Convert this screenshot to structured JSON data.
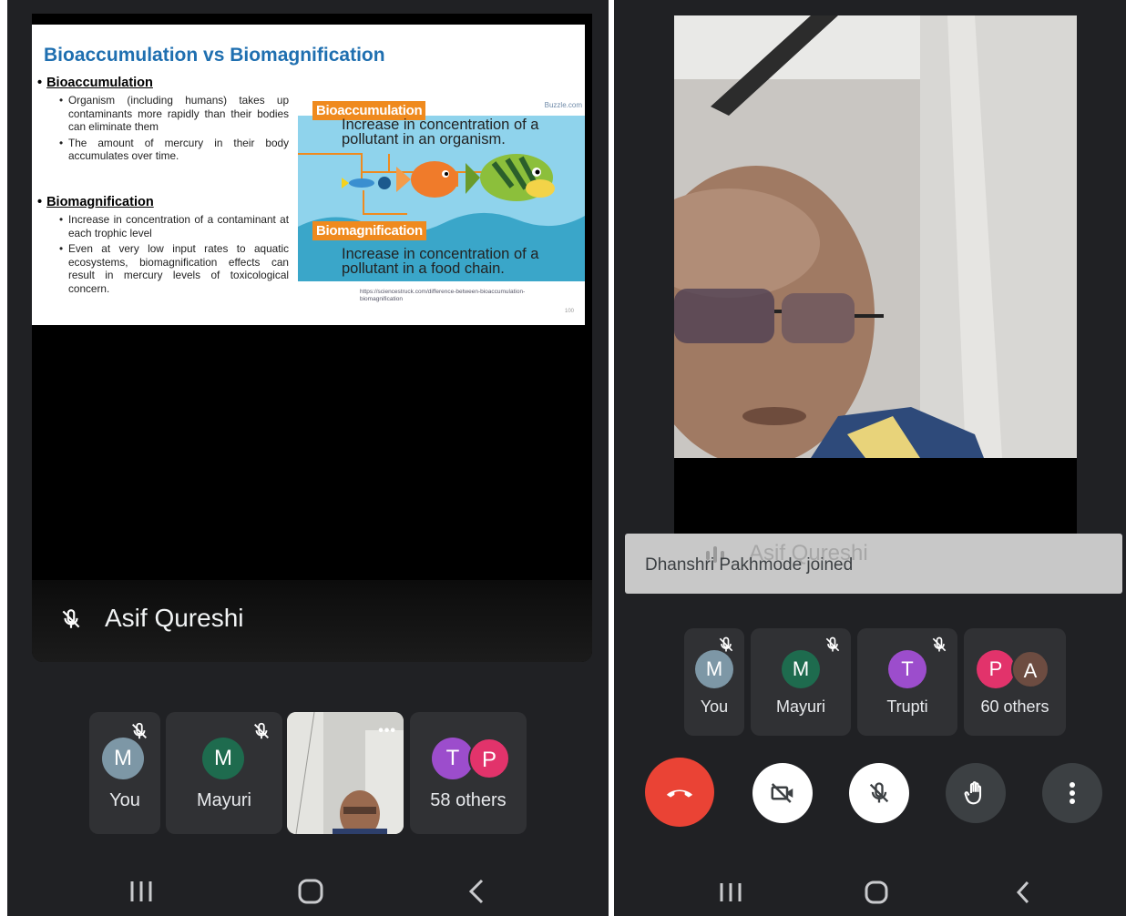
{
  "left": {
    "slide": {
      "title": "Bioaccumulation vs Biomagnification",
      "section1": "Bioaccumulation",
      "section1_bullets": [
        "Organism (including humans) takes up contaminants more rapidly than their bodies can eliminate them",
        "The amount of mercury in their body accumulates over time."
      ],
      "section2": "Biomagnification",
      "section2_bullets": [
        "Increase in concentration of a contaminant at each trophic level",
        "Even at very low input rates to aquatic ecosystems, biomagnification effects can result in mercury levels of toxicological concern."
      ],
      "illustration": {
        "credit": "Buzzle.com",
        "tag1": "Bioaccumulation",
        "desc1": "Increase in concentration of a pollutant in an organism.",
        "tag2": "Biomagnification",
        "desc2": "Increase in concentration of a pollutant in a food chain."
      },
      "source": "https://sciencestruck.com/difference-between-bioaccumulation-biomagnification",
      "page": "100"
    },
    "speaker_name": "Asif Qureshi",
    "participants": [
      {
        "initial": "M",
        "label": "You",
        "color": "#7d97a6",
        "muted": true
      },
      {
        "initial": "M",
        "label": "Mayuri",
        "color": "#1e6b4e",
        "muted": true
      }
    ],
    "others": {
      "initials": [
        "T",
        "P"
      ],
      "colors": [
        "#9c4dcc",
        "#e2336b"
      ],
      "label": "58 others"
    },
    "more_icon": "more-horizontal-icon"
  },
  "right": {
    "toast": "Dhanshri Pakhmode joined",
    "speaker_name": "Asif Qureshi",
    "participants": [
      {
        "initial": "M",
        "label": "You",
        "color": "#7d97a6",
        "muted": true
      },
      {
        "initial": "M",
        "label": "Mayuri",
        "color": "#1e6b4e",
        "muted": true
      },
      {
        "initial": "T",
        "label": "Trupti",
        "color": "#9c4dcc",
        "muted": true
      }
    ],
    "others": {
      "initials": [
        "P",
        "A"
      ],
      "colors": [
        "#e2336b",
        "#6d4c41"
      ],
      "label": "60 others"
    },
    "controls": [
      "end-call-icon",
      "camera-off-icon",
      "mic-off-icon",
      "raise-hand-icon",
      "more-vertical-icon"
    ]
  },
  "colors": {
    "end_call": "#ea4335",
    "background": "#202124",
    "tile": "#303134"
  },
  "navbar": {
    "icons": [
      "recent-apps-icon",
      "home-icon",
      "back-icon"
    ]
  }
}
